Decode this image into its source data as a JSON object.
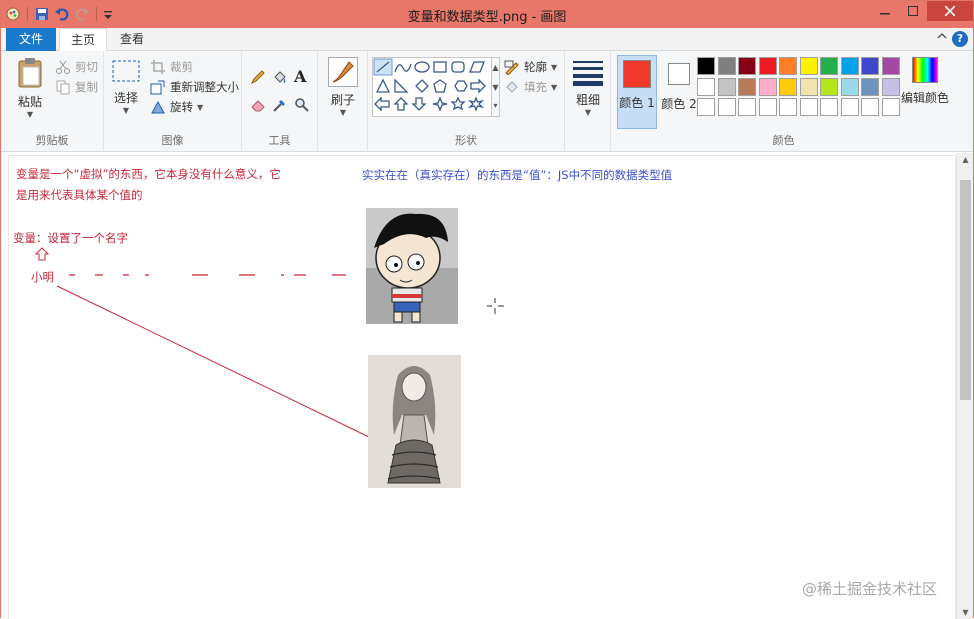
{
  "window": {
    "title": "变量和数据类型.png - 画图"
  },
  "tabs": {
    "file": "文件",
    "home": "主页",
    "view": "查看"
  },
  "clipboard": {
    "paste": "粘贴",
    "cut": "剪切",
    "copy": "复制",
    "group": "剪贴板"
  },
  "image": {
    "select": "选择",
    "crop": "裁剪",
    "resize": "重新调整大小",
    "rotate": "旋转",
    "group": "图像"
  },
  "tools": {
    "group": "工具"
  },
  "brushes": {
    "label": "刷子"
  },
  "shapes": {
    "outline": "轮廓",
    "fill": "填充",
    "group": "形状"
  },
  "size": {
    "label": "粗细"
  },
  "colors": {
    "color1": "颜色 1",
    "color2": "颜色 2",
    "edit": "编辑颜色",
    "group": "颜色",
    "color1_value": "#f03a2a",
    "color2_value": "#ffffff",
    "row1": [
      "#000000",
      "#7f7f7f",
      "#880015",
      "#ed1c24",
      "#ff7f27",
      "#fff200",
      "#22b14c",
      "#00a2e8",
      "#3f48cc",
      "#a349a4"
    ],
    "row2": [
      "#ffffff",
      "#c3c3c3",
      "#b97a57",
      "#ffaec9",
      "#ffc90e",
      "#efe4b0",
      "#b5e61d",
      "#99d9ea",
      "#7092be",
      "#c8bfe7"
    ],
    "row3": [
      "#ffffff",
      "#ffffff",
      "#ffffff",
      "#ffffff",
      "#ffffff",
      "#ffffff",
      "#ffffff",
      "#ffffff",
      "#ffffff",
      "#ffffff"
    ]
  },
  "canvas": {
    "red_line1": "变量是一个“虚拟”的东西，它本身没有什么意义，它",
    "red_line2": "是用来代表具体某个值的",
    "red_line3": "变量：设置了一个名字",
    "name_label": "小明",
    "blue_line1": "实实在在（真实存在）的东西是“值”：JS中不同的数据类型值",
    "accent_red": "#c8273b",
    "accent_blue": "#3a4fd0"
  },
  "watermark": "@稀土掘金技术社区"
}
